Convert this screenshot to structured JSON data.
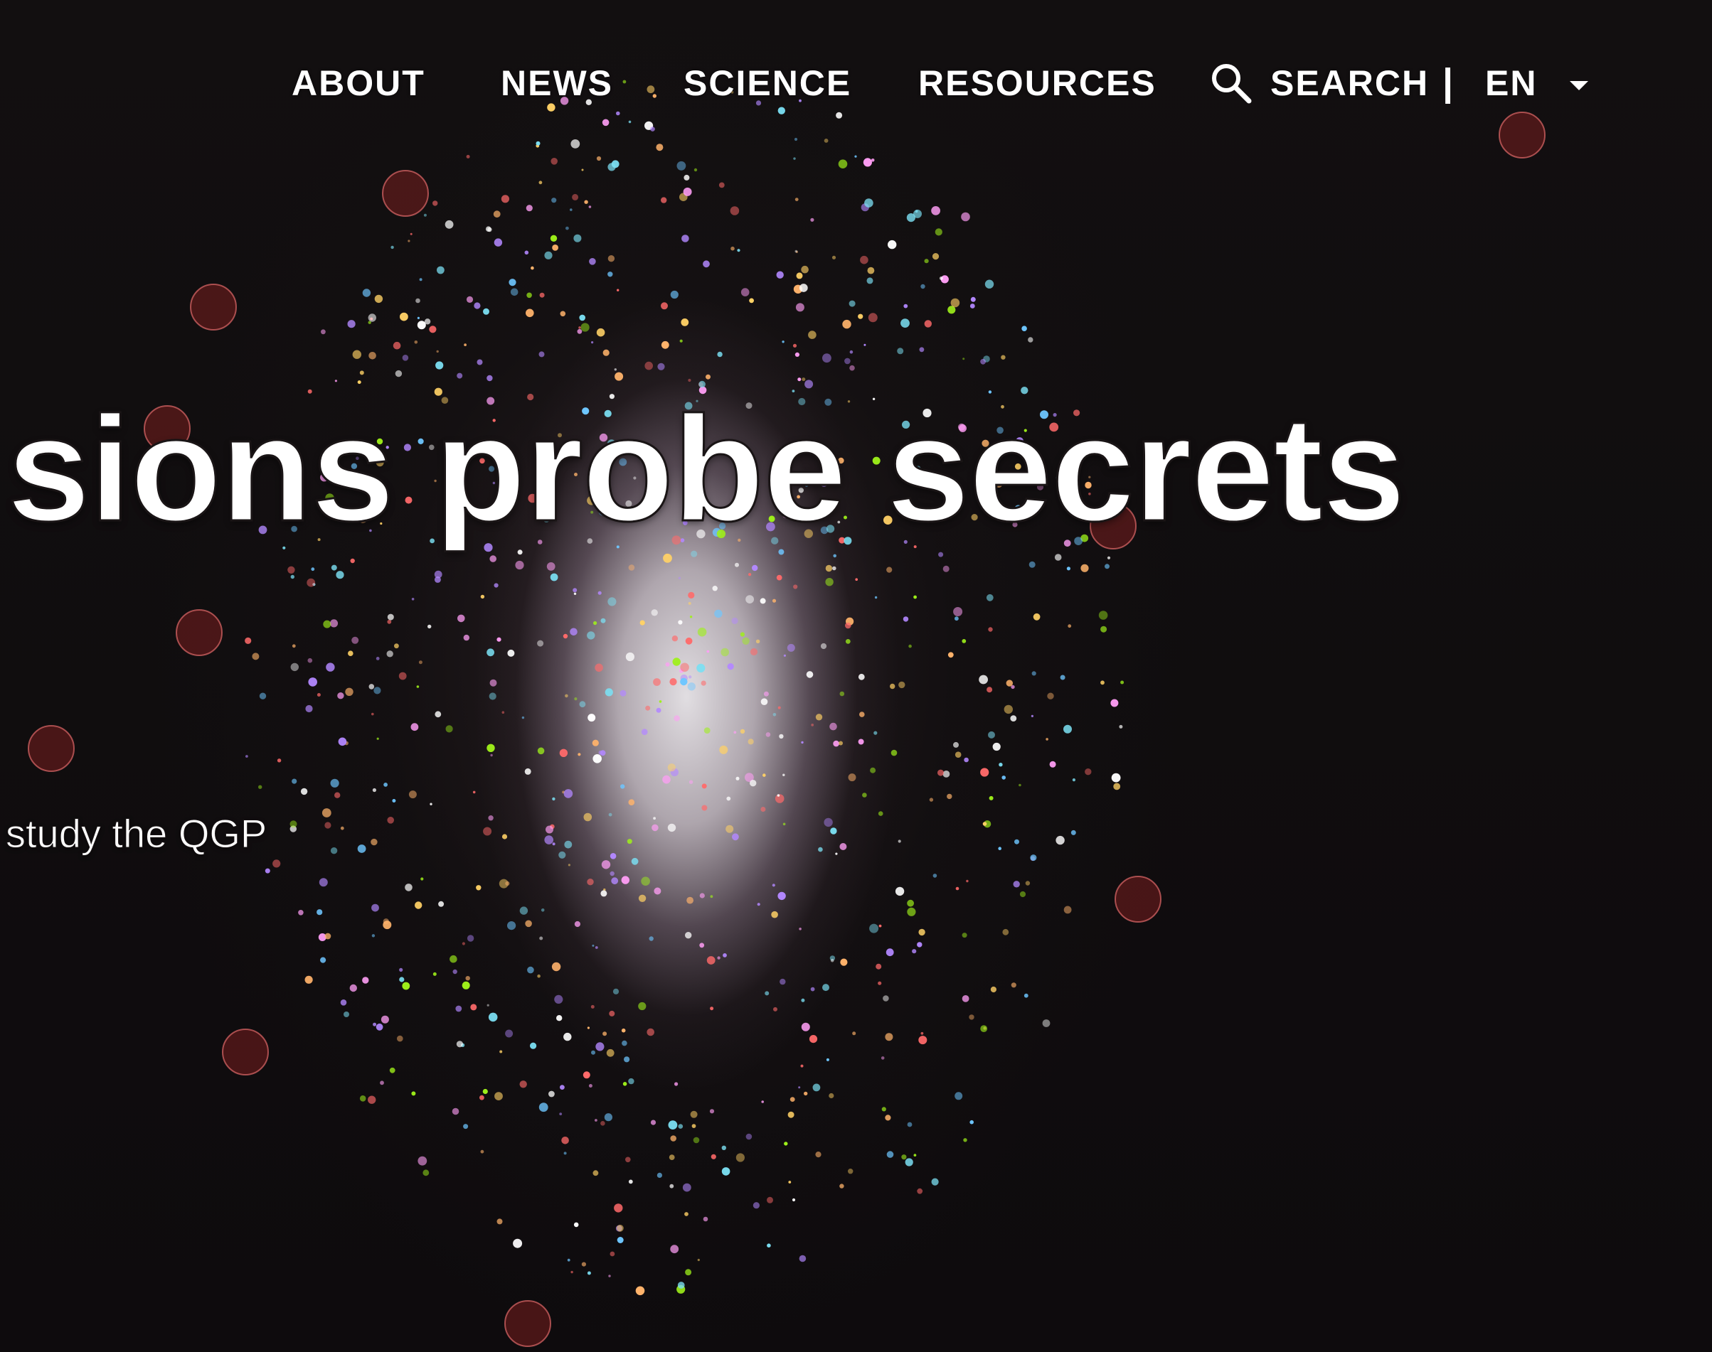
{
  "nav": {
    "items": [
      {
        "label": "ABOUT"
      },
      {
        "label": "NEWS"
      },
      {
        "label": "SCIENCE"
      },
      {
        "label": "RESOURCES"
      }
    ],
    "search_label": "SEARCH",
    "divider": "|",
    "language": "EN",
    "icons": {
      "search": "search-icon",
      "language_dropdown": "caret-down-icon"
    }
  },
  "hero": {
    "headline": "sions probe secrets",
    "subtitle": "study the QGP",
    "background": "particle-collision-image"
  },
  "colors": {
    "text": "#ffffff",
    "background": "#0d0b0c"
  }
}
